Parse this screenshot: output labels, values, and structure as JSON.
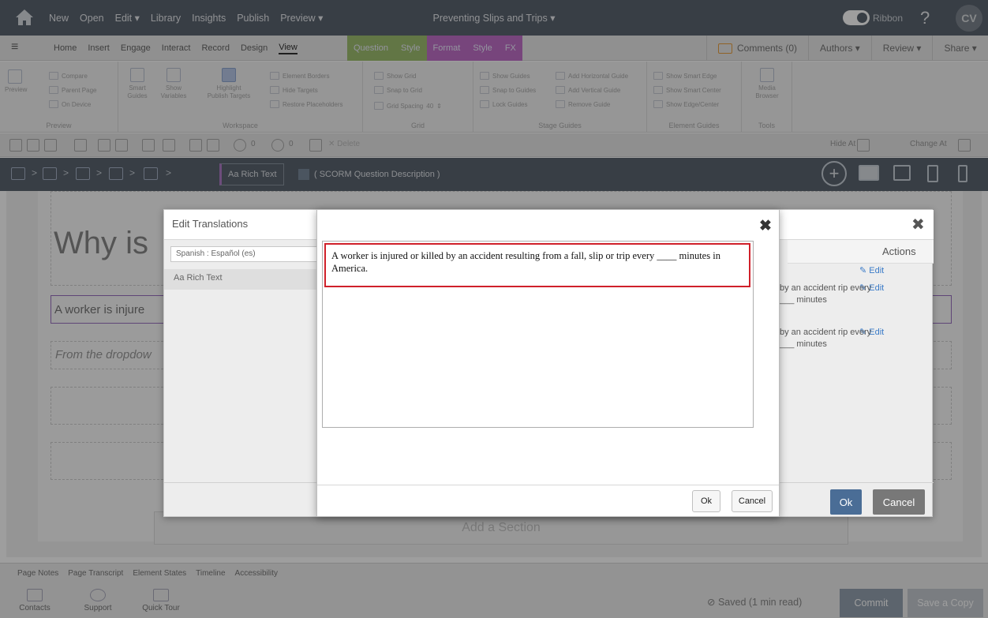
{
  "topbar": {
    "menu": [
      "New",
      "Open",
      "Edit ▾",
      "Library",
      "Insights",
      "Publish",
      "Preview ▾"
    ],
    "title": "Preventing Slips and Trips ▾",
    "ribbon_label": "Ribbon",
    "help": "?",
    "avatar": "CV"
  },
  "tabs": {
    "items": [
      "Home",
      "Insert",
      "Engage",
      "Interact",
      "Record",
      "Design",
      "View"
    ],
    "context": [
      "Question",
      "Style",
      "Format",
      "Style",
      "FX"
    ],
    "comments": "Comments (0)",
    "authors": "Authors ▾",
    "review": "Review ▾",
    "share": "Share ▾"
  },
  "ribbon": {
    "preview": {
      "label": "Preview",
      "compare": "Compare",
      "parent_page": "Parent Page",
      "on_device": "On Device",
      "group": "Preview"
    },
    "workspace": {
      "smart_guides": "Smart Guides",
      "show_variables": "Show Variables",
      "highlight": "Highlight Publish Targets",
      "element_borders": "Element Borders",
      "hide_targets": "Hide Targets",
      "restore": "Restore Placeholders",
      "group": "Workspace"
    },
    "grid": {
      "show_grid": "Show Grid",
      "snap_grid": "Snap to Grid",
      "grid_spacing": "Grid Spacing",
      "grid_spacing_value": "40",
      "group": "Grid"
    },
    "stage_guides": {
      "show_guides": "Show Guides",
      "snap_guides": "Snap to Guides",
      "lock_guides": "Lock Guides",
      "add_h": "Add Horizontal Guide",
      "add_v": "Add Vertical Guide",
      "remove": "Remove Guide",
      "group": "Stage Guides"
    },
    "element_guides": {
      "smart_edge": "Show Smart Edge",
      "smart_center": "Show Smart Center",
      "edge_center": "Show Edge/Center",
      "group": "Element Guides"
    },
    "tools": {
      "media": "Media Browser",
      "group": "Tools"
    }
  },
  "toolbar2": {
    "opacity": "0",
    "rotate": "0",
    "delete": "Delete",
    "hide_at": "Hide At",
    "change_at": "Change At"
  },
  "breadcrumb": {
    "rich_text": "Aa Rich Text",
    "scorm": "( SCORM Question Description )"
  },
  "canvas": {
    "title": "Why is",
    "question_text": "A worker is injure",
    "instruction": "From the dropdow",
    "add_section": "Add a Section"
  },
  "translations": {
    "title": "Edit Translations",
    "language": "Spanish : Español (es)",
    "selected_item": "Aa Rich Text",
    "actions_header": "Actions",
    "edit": "Edit",
    "row1": "by an accident rip every ___ minutes",
    "row2": "by an accident rip every ___ minutes",
    "ok": "Ok",
    "cancel": "Cancel"
  },
  "editor_modal": {
    "text": "A worker is injured or killed by an accident resulting from a fall, slip or trip every ____ minutes in America.",
    "ok": "Ok",
    "cancel": "Cancel"
  },
  "footer": {
    "tabs": [
      "Page Notes",
      "Page Transcript",
      "Element States",
      "Timeline",
      "Accessibility"
    ],
    "contacts": "Contacts",
    "support": "Support",
    "quick_tour": "Quick Tour",
    "saved": "⊘ Saved (1 min read)",
    "commit": "Commit",
    "save_copy": "Save a Copy"
  }
}
